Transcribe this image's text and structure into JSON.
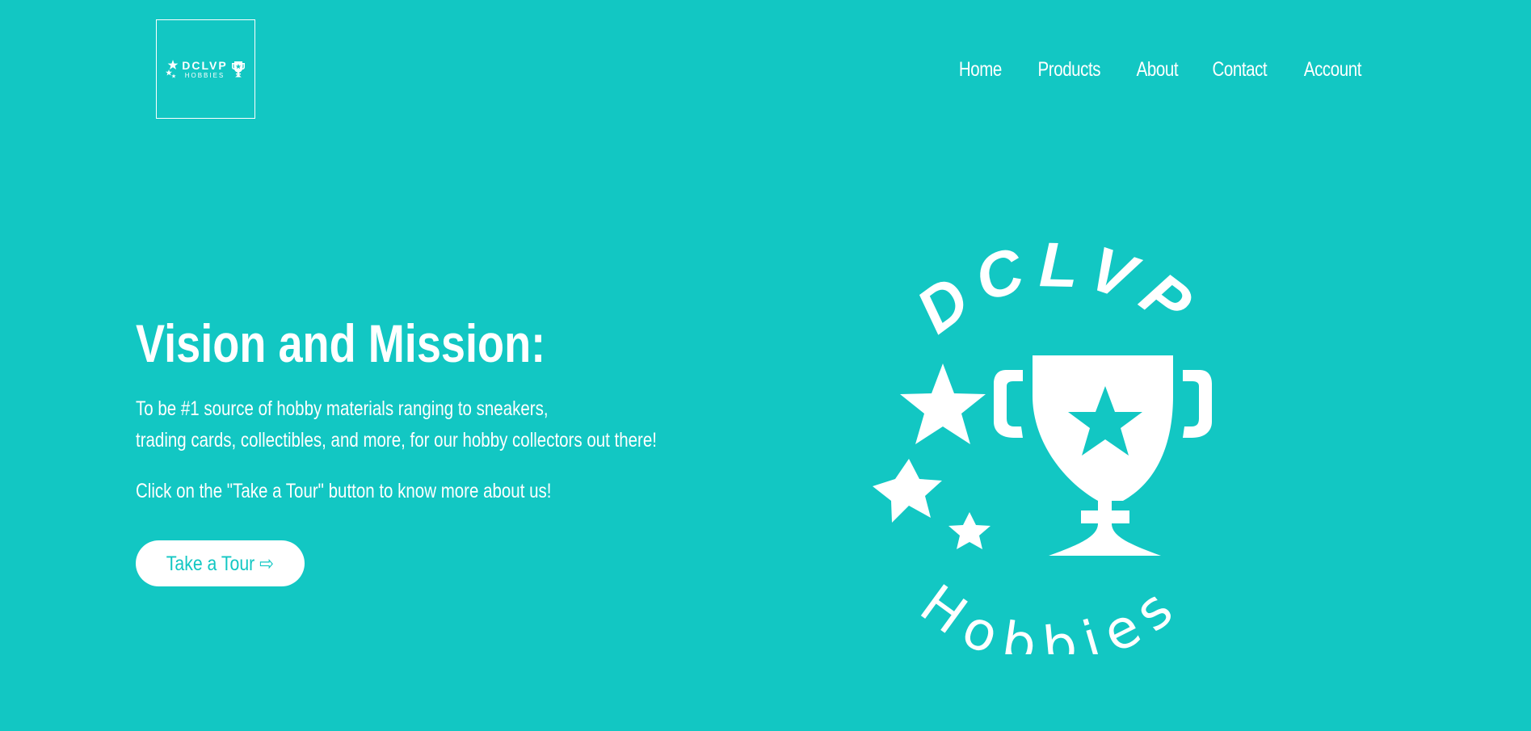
{
  "header": {
    "logo": {
      "brand": "DCLVP",
      "sub": "HOBBIES"
    },
    "nav": [
      {
        "label": "Home"
      },
      {
        "label": "Products"
      },
      {
        "label": "About"
      },
      {
        "label": "Contact"
      },
      {
        "label": "Account"
      }
    ]
  },
  "hero": {
    "title": "Vision and Mission:",
    "description_line1": "To be #1 source of hobby materials ranging to sneakers,",
    "description_line2": "trading cards, collectibles, and more, for our hobby collectors out there!",
    "note": "Click on the \"Take a Tour\" button to know more about us!",
    "button_label": "Take a Tour",
    "button_icon": "arrow-right-icon",
    "button_glyph": "⇨"
  },
  "emblem": {
    "top_text": "DCLVP",
    "bottom_text": "Hobbies"
  },
  "colors": {
    "background": "#12c7c3",
    "foreground": "#ffffff"
  }
}
